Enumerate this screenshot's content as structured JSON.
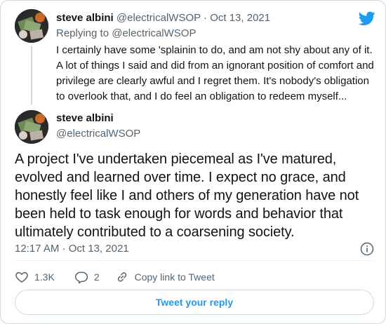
{
  "colors": {
    "accent": "#1d9bf0",
    "muted": "#536471",
    "text": "#0f1419",
    "border": "#cfd9de"
  },
  "reply_tweet": {
    "author_name": "steve albini",
    "author_handle": "@electricalWSOP",
    "separator": "·",
    "date": "Oct 13, 2021",
    "replying_prefix": "Replying to",
    "replying_handle": "@electricalWSOP",
    "text": "I certainly have some 'splainin to do, and am not shy about any of it. A lot of things I said and did from an ignorant position of comfort and privilege are clearly awful and I regret them. It's nobody's obligation to overlook that, and I do feel an obligation to redeem myself..."
  },
  "main_tweet": {
    "author_name": "steve albini",
    "author_handle": "@electricalWSOP",
    "text": "A project I've undertaken piecemeal as I've matured, evolved and learned over time. I expect no grace, and honestly feel like I and others of my generation have not been held to task enough for words and behavior that ultimately contributed to a coarsening society.",
    "time": "12:17 AM",
    "separator": "·",
    "date": "Oct 13, 2021"
  },
  "actions": {
    "like_count": "1.3K",
    "reply_count": "2",
    "copy_link_label": "Copy link to Tweet"
  },
  "tweet_reply_label": "Tweet your reply",
  "icons": {
    "brand": "twitter-bird-icon",
    "info": "info-icon",
    "like": "heart-icon",
    "reply": "reply-bubble-icon",
    "copy": "link-icon"
  }
}
